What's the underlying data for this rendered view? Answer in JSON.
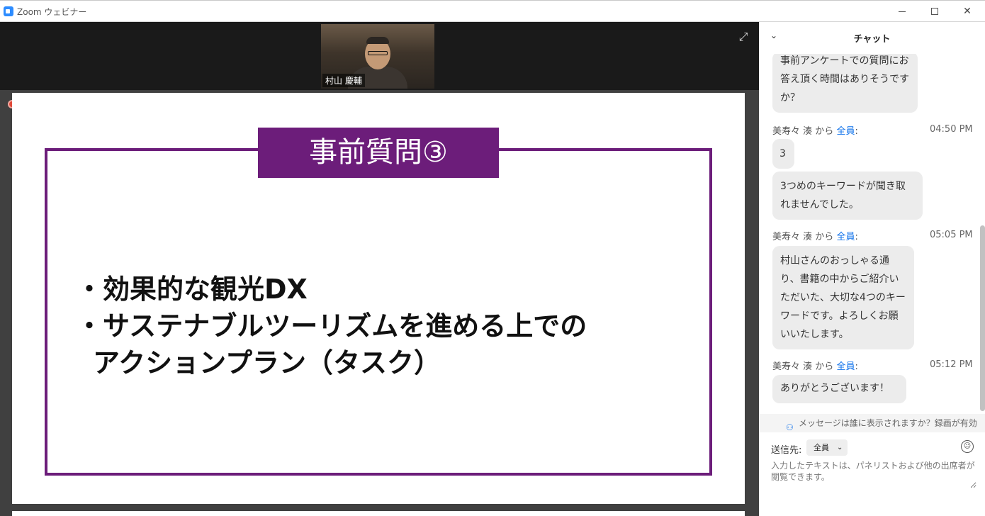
{
  "window": {
    "title": "Zoom ウェビナー"
  },
  "participant": {
    "name": "村山 慶輔"
  },
  "slide": {
    "title": "事前質問③",
    "bullets": [
      "・効果的な観光DX",
      "・サステナブルツーリズムを進める上での",
      "アクションプラン（タスク）"
    ]
  },
  "chat": {
    "title": "チャット",
    "messages": [
      {
        "text": "事前アンケートでの質問にお答え頂く時間はありそうですか？"
      },
      {
        "sender": "美寿々 湊",
        "from_word": "から",
        "to": "全員",
        "time": "04:50 PM",
        "text": "3"
      },
      {
        "text": "3つめのキーワードが聞き取れませんでした。"
      },
      {
        "sender": "美寿々 湊",
        "from_word": "から",
        "to": "全員",
        "time": "05:05 PM",
        "text": "村山さんのおっしゃる通り、書籍の中からご紹介いただいた、大切な4つのキーワードです。よろしくお願いいたします。"
      },
      {
        "sender": "美寿々 湊",
        "from_word": "から",
        "to": "全員",
        "time": "05:12 PM",
        "text": "ありがとうございます！"
      }
    ],
    "visibility_notice": "メッセージは誰に表示されますか？録画が有効",
    "send_to_label": "送信先:",
    "recipient": "全員",
    "input_placeholder": "入力したテキストは、パネリストおよび他の出席者が閲覧できます。"
  },
  "colors": {
    "accent": "#6c1d7a",
    "link": "#0e71eb",
    "zoom_blue": "#2d8cff"
  }
}
